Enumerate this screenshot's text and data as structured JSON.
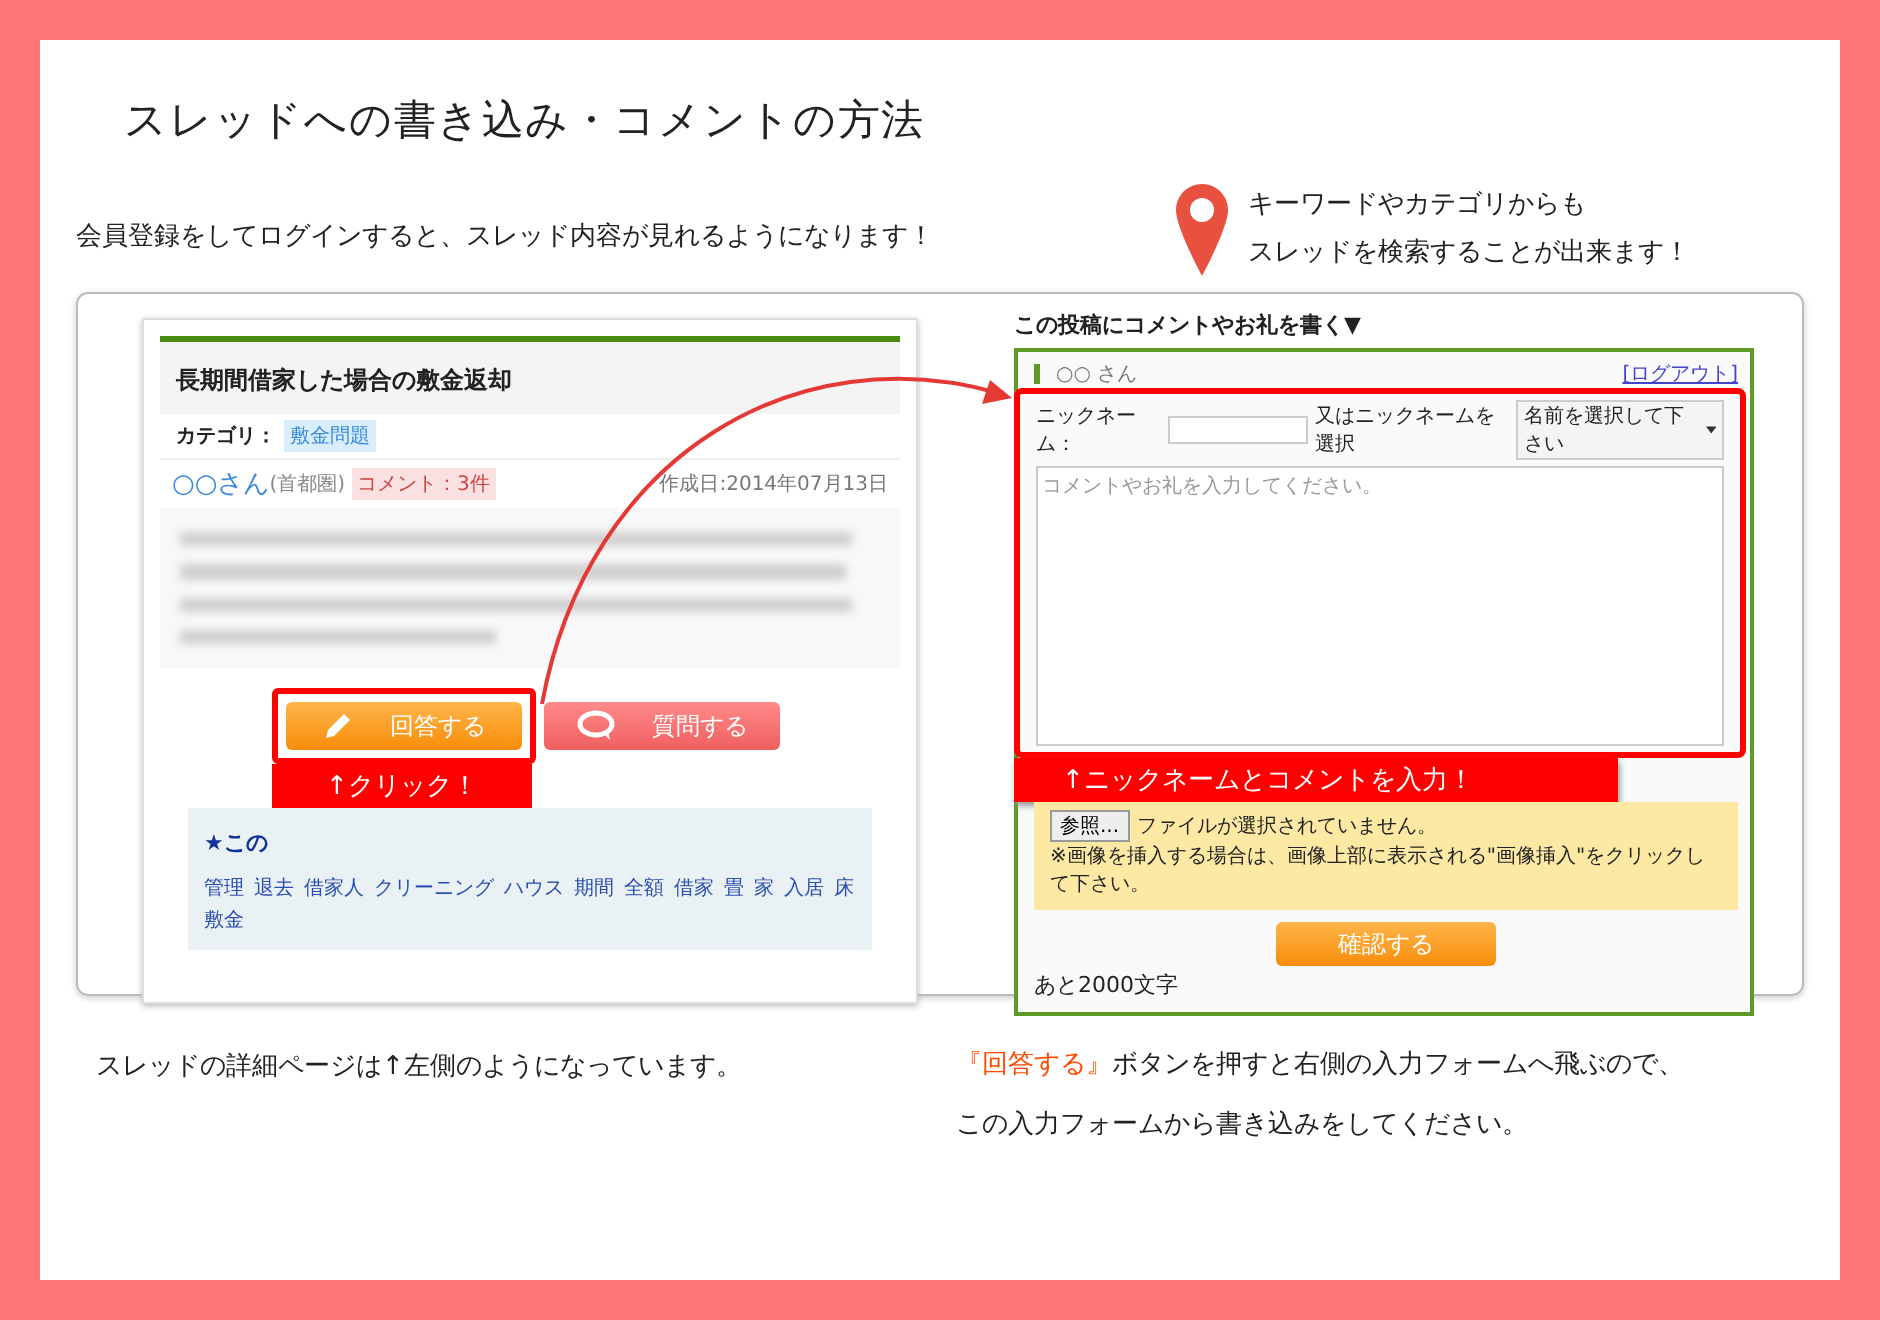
{
  "title": "スレッドへの書き込み・コメントの方法",
  "intro": "会員登録をしてログインすると、スレッド内容が見れるようになります！",
  "search_note": [
    "キーワードやカテゴリからも",
    "スレッドを検索することが出来ます！"
  ],
  "thread": {
    "title": "長期間借家した場合の敷金返却",
    "category_label": "カテゴリ：",
    "category": "敷金問題",
    "author": "○○さん",
    "region": "(首都圏)",
    "comments": "コメント：3件",
    "date": "作成日:2014年07月13日",
    "answer_button": "回答する",
    "question_button": "質問する",
    "click_label": "↑クリック！",
    "tags_heading": "★この",
    "tags": [
      "管理",
      "退去",
      "借家人",
      "クリーニング",
      "ハウス",
      "期間",
      "全額",
      "借家",
      "畳",
      "家",
      "入居",
      "床",
      "敷金"
    ]
  },
  "form": {
    "heading": "この投稿にコメントやお礼を書く▼",
    "user": "○○ さん",
    "logout": "[ログアウト]",
    "nickname_label": "ニックネーム：",
    "or_select": "又はニックネームを選択",
    "select_value": "名前を選択して下さい",
    "comment_placeholder": "コメントやお礼を入力してください。",
    "input_label": "↑ニックネームとコメントを入力！",
    "browse_button": "参照...",
    "no_file": "ファイルが選択されていません。",
    "image_note": "※画像を挿入する場合は、画像上部に表示される\"画像挿入\"をクリックして下さい。",
    "confirm_button": "確認する",
    "remaining": "あと2000文字"
  },
  "caption_left": "スレッドの詳細ページは↑左側のようになっています。",
  "caption_right": {
    "highlight": "『回答する』",
    "rest": "ボタンを押すと右側の入力フォームへ飛ぶので、",
    "line2": "この入力フォームから書き込みをしてください。"
  }
}
